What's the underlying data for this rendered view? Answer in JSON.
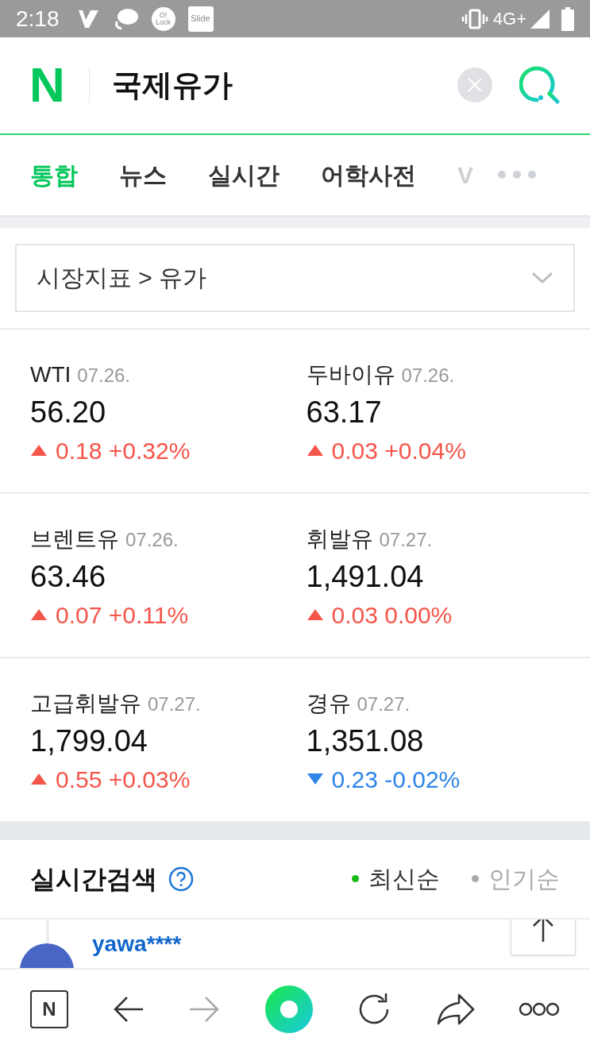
{
  "status_bar": {
    "time": "2:18",
    "notification_labels": [
      "O!\nLock",
      "Slide"
    ],
    "network": "4G+"
  },
  "header": {
    "logo": "N",
    "query": "국제유가"
  },
  "tabs": [
    {
      "label": "통합",
      "selected": true
    },
    {
      "label": "뉴스",
      "selected": false
    },
    {
      "label": "실시간",
      "selected": false
    },
    {
      "label": "어학사전",
      "selected": false
    },
    {
      "label": "V",
      "selected": false
    }
  ],
  "breadcrumb": {
    "parent": "시장지표",
    "separator": ">",
    "current": "유가"
  },
  "quotes": [
    {
      "name": "WTI",
      "date": "07.26.",
      "price": "56.20",
      "rising": true,
      "change": "0.18",
      "percent": "+0.32%"
    },
    {
      "name": "두바이유",
      "date": "07.26.",
      "price": "63.17",
      "rising": true,
      "change": "0.03",
      "percent": "+0.04%"
    },
    {
      "name": "브렌트유",
      "date": "07.26.",
      "price": "63.46",
      "rising": true,
      "change": "0.07",
      "percent": "+0.11%"
    },
    {
      "name": "휘발유",
      "date": "07.27.",
      "price": "1,491.04",
      "rising": true,
      "change": "0.03",
      "percent": "0.00%"
    },
    {
      "name": "고급휘발유",
      "date": "07.27.",
      "price": "1,799.04",
      "rising": true,
      "change": "0.55",
      "percent": "+0.03%"
    },
    {
      "name": "경유",
      "date": "07.27.",
      "price": "1,351.08",
      "rising": false,
      "change": "0.23",
      "percent": "-0.02%"
    }
  ],
  "realtime": {
    "title": "실시간검색",
    "sorts": [
      {
        "label": "최신순",
        "selected": true
      },
      {
        "label": "인기순",
        "selected": false
      }
    ],
    "first_user": "yawa****"
  },
  "bottom_bar": {
    "logo": "N"
  }
}
